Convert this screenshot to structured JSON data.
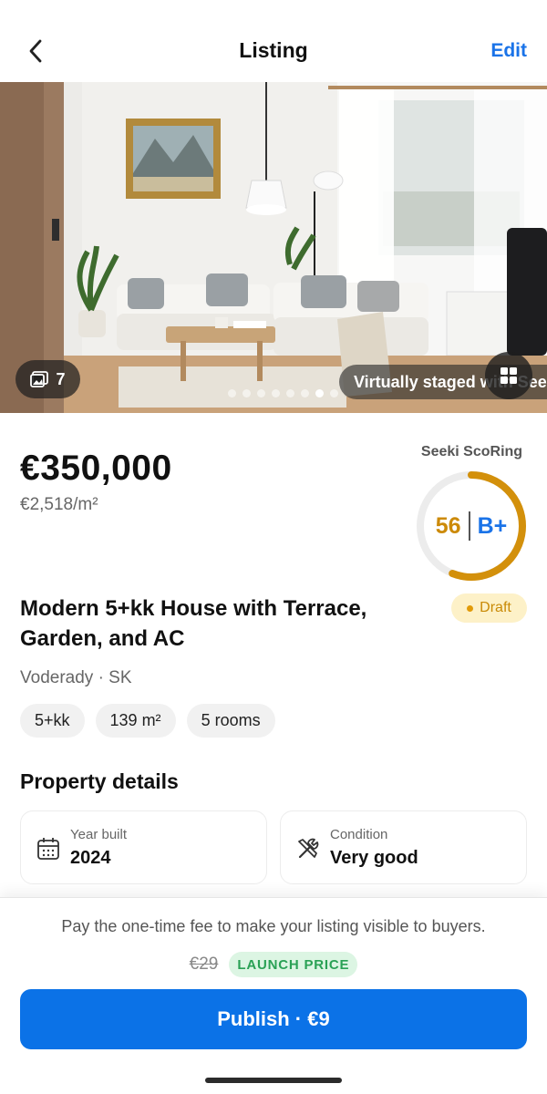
{
  "header": {
    "title": "Listing",
    "edit_label": "Edit",
    "back_icon": "chevron-left-icon"
  },
  "gallery": {
    "photo_count": "7",
    "dots_total": 8,
    "active_dot": 7,
    "staged_label": "Virtually staged with Seeki"
  },
  "listing": {
    "price": "€350,000",
    "price_per_m2": "€2,518/m²",
    "title": "Modern 5+kk House with Terrace, Garden, and AC",
    "status": "Draft",
    "location": "Voderady · SK",
    "chips": [
      "5+kk",
      "139 m²",
      "5 rooms"
    ]
  },
  "score": {
    "label": "Seeki ScoRing",
    "value": "56",
    "grade": "B+",
    "fraction": 0.56,
    "ring_color": "#d3900b",
    "track_color": "#ececec"
  },
  "details": {
    "title": "Property details",
    "items": [
      {
        "label": "Year built",
        "value": "2024",
        "icon": "calendar-icon"
      },
      {
        "label": "Condition",
        "value": "Very good",
        "icon": "tools-icon"
      }
    ]
  },
  "footer": {
    "fee_text": "Pay the one-time fee to make your listing visible to buyers.",
    "old_price": "€29",
    "launch_badge": "LAUNCH PRICE",
    "publish_label": "Publish · €9"
  },
  "colors": {
    "accent": "#0b72e7",
    "draft": "#c98a06",
    "launch": "#2aa155"
  }
}
